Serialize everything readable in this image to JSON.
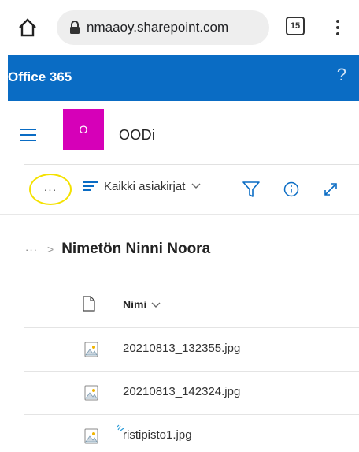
{
  "browser": {
    "url": "nmaaoy.sharepoint.com",
    "tab_count": "15"
  },
  "suite_bar": {
    "title": "Office 365",
    "help": "?",
    "color": "#0a6cc4"
  },
  "site": {
    "logo_letter": "O",
    "logo_color": "#d600b8",
    "name": "OODi"
  },
  "command_bar": {
    "more": "···",
    "view_label": "Kaikki asiakirjat",
    "icons": [
      "filter-icon",
      "info-icon",
      "expand-icon"
    ]
  },
  "breadcrumb": {
    "more": "···",
    "separator": ">",
    "current": "Nimetön Ninni Noora"
  },
  "list": {
    "name_header": "Nimi",
    "files": [
      {
        "name": "20210813_132355.jpg"
      },
      {
        "name": "20210813_142324.jpg"
      },
      {
        "name": "ristipisto1.jpg"
      }
    ]
  }
}
